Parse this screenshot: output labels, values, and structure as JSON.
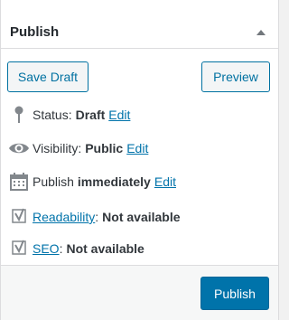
{
  "header": {
    "title": "Publish"
  },
  "actions": {
    "save_draft": "Save Draft",
    "preview": "Preview",
    "publish": "Publish"
  },
  "status": {
    "label": "Status:",
    "value": "Draft",
    "edit": "Edit"
  },
  "visibility": {
    "label": "Visibility:",
    "value": "Public",
    "edit": "Edit"
  },
  "schedule": {
    "label": "Publish",
    "value": "immediately",
    "edit": "Edit"
  },
  "readability": {
    "link": "Readability",
    "sep": ":",
    "value": "Not available"
  },
  "seo": {
    "link": "SEO",
    "sep": ":",
    "value": "Not available"
  },
  "icons": {
    "status": "pin-icon",
    "visibility": "eye-icon",
    "schedule": "calendar-icon",
    "readability": "yoast-icon",
    "seo": "yoast-icon",
    "toggle": "triangle-up-icon"
  },
  "colors": {
    "accent": "#0073aa",
    "button_border": "#0071a1",
    "icon": "#82878c"
  }
}
